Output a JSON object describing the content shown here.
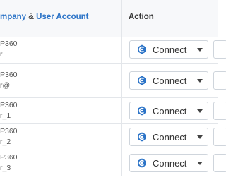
{
  "header": {
    "company_label": "mpany",
    "ampersand": "&",
    "user_account_label": "User Account",
    "action_label": "Action"
  },
  "rows": [
    {
      "line1": "P360",
      "line2": "r",
      "connect_label": "Connect"
    },
    {
      "line1": "P360",
      "line2": "r@",
      "connect_label": "Connect"
    },
    {
      "line1": "P360",
      "line2": "r_1",
      "connect_label": "Connect"
    },
    {
      "line1": "P360",
      "line2": "r_2",
      "connect_label": "Connect"
    },
    {
      "line1": "P360",
      "line2": "r_3",
      "connect_label": "Connect"
    }
  ],
  "colors": {
    "link": "#2b73c7",
    "icon": "#2b73c7",
    "header_bg": "#f7f8fa",
    "border": "#e3e6ea"
  },
  "icons": {
    "connect": "connect-icon",
    "dropdown": "chevron-down-icon"
  }
}
